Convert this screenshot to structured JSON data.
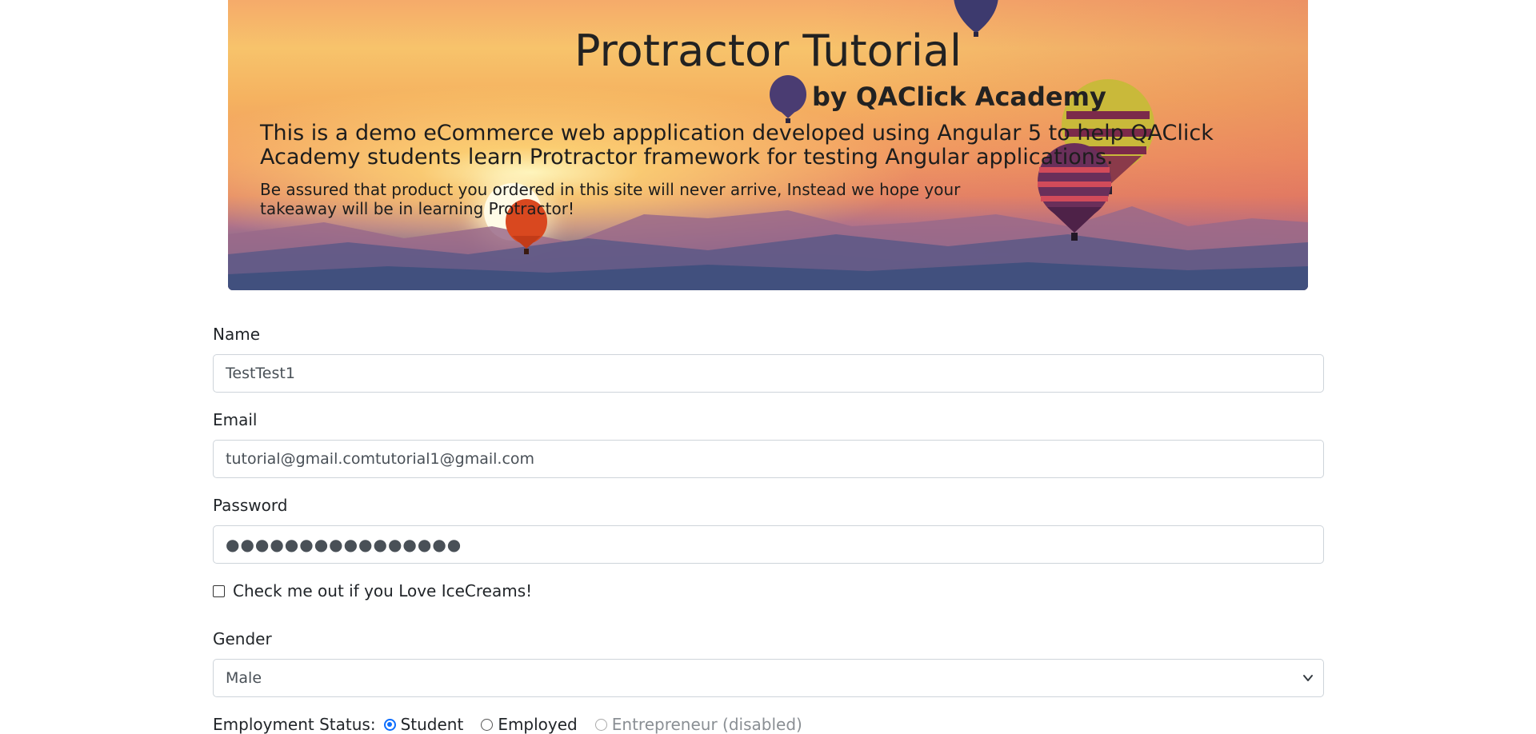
{
  "hero": {
    "title": "Protractor Tutorial",
    "subtitle": "by QAClick Academy",
    "lead": "This is a demo eCommerce web appplication developed using Angular 5 to help QAClick Academy students learn Protractor framework for testing Angular applications.",
    "note": "Be assured that product you ordered in this site will never arrive, Instead we hope your takeaway will be in learning Protractor!"
  },
  "form": {
    "name": {
      "label": "Name",
      "value": "TestTest1"
    },
    "email": {
      "label": "Email",
      "value": "tutorial@gmail.comtutorial1@gmail.com"
    },
    "password": {
      "label": "Password",
      "value": "●●●●●●●●●●●●●●●●"
    },
    "icecream": {
      "label": "Check me out if you Love IceCreams!",
      "checked": false
    },
    "gender": {
      "label": "Gender",
      "selected": "Male"
    },
    "employment": {
      "label": "Employment Status:",
      "options": [
        {
          "label": "Student",
          "checked": true
        },
        {
          "label": "Employed",
          "checked": false
        },
        {
          "label": "Entrepreneur (disabled)",
          "checked": false,
          "disabled": true
        }
      ]
    }
  },
  "colors": {
    "accent": "#0d6efd",
    "border": "#ced4da",
    "text": "#212529"
  }
}
